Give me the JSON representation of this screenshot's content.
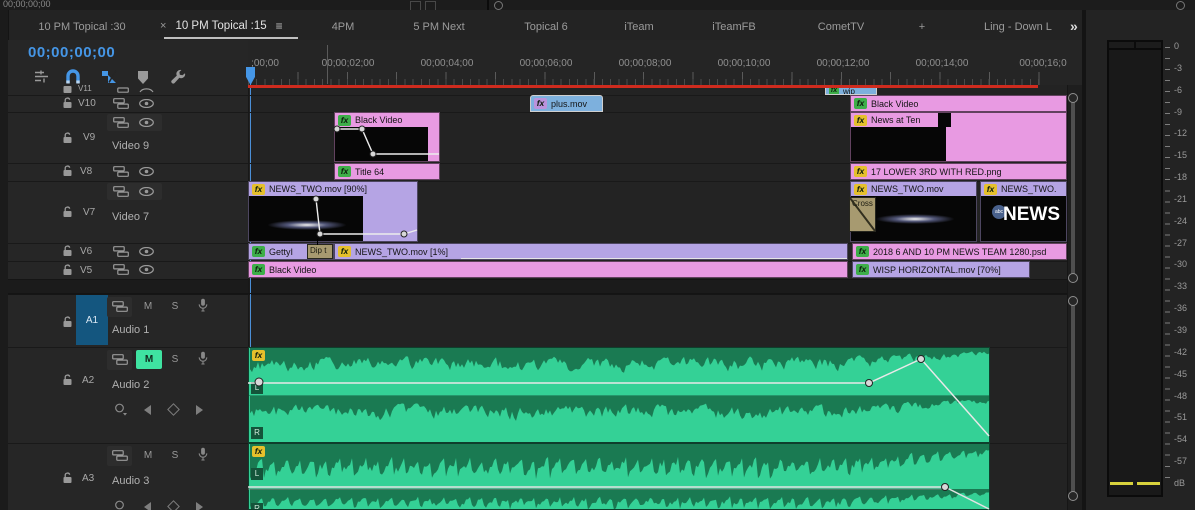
{
  "top_strip": {
    "timecode": "00;00;00;00"
  },
  "tab_bar": {
    "tabs": [
      {
        "label": "10 PM Topical :30"
      },
      {
        "label": "10 PM Topical :15",
        "close": "×",
        "menu": "≡"
      },
      {
        "label": "4PM"
      },
      {
        "label": "5 PM Next"
      },
      {
        "label": "Topical 6"
      },
      {
        "label": "iTeam"
      },
      {
        "label": "iTeamFB"
      },
      {
        "label": "CometTV"
      },
      {
        "label": "+"
      },
      {
        "label": "Ling - Down L"
      }
    ],
    "overflow": "»"
  },
  "toolbar": {
    "timecode": "00;00;00;00"
  },
  "ruler": {
    "labels": [
      ";00;00",
      "00;00;02;00",
      "00;00;04;00",
      "00;00;06;00",
      "00;00;08;00",
      "00;00;10;00",
      "00;00;12;00",
      "00;00;14;00",
      "00;00;16;0"
    ]
  },
  "tracks": {
    "v11": {
      "id": "V11"
    },
    "v10": {
      "id": "V10"
    },
    "v9": {
      "id": "V9",
      "name": "Video 9"
    },
    "v8": {
      "id": "V8"
    },
    "v7": {
      "id": "V7",
      "name": "Video 7"
    },
    "v6": {
      "id": "V6"
    },
    "v5": {
      "id": "V5"
    },
    "a1": {
      "id": "A1",
      "name": "Audio 1",
      "mute": "M",
      "solo": "S"
    },
    "a2": {
      "id": "A2",
      "name": "Audio 2",
      "mute": "M",
      "solo": "S"
    },
    "a3": {
      "id": "A3",
      "name": "Audio 3",
      "mute": "M",
      "solo": "S"
    }
  },
  "clips": {
    "wip": {
      "label": "wip"
    },
    "plus": {
      "label": "plus.mov"
    },
    "v10_black": {
      "label": "Black Video"
    },
    "v9_black": {
      "label": "Black Video"
    },
    "news_at_ten": {
      "label": "News at Ten"
    },
    "title_64": {
      "label": "Title 64"
    },
    "lower_third": {
      "label": "17 LOWER 3RD WITH RED.png"
    },
    "news_two_90": {
      "label": "NEWS_TWO.mov [90%]"
    },
    "news_two_a": {
      "label": "NEWS_TWO.mov"
    },
    "news_two_b": {
      "label": "NEWS_TWO."
    },
    "getty": {
      "label": "GettyI"
    },
    "news_two_1": {
      "label": "NEWS_TWO.mov [1%]"
    },
    "team_psd": {
      "label": "2018 6 AND 10 PM NEWS TEAM 1280.psd"
    },
    "v5_black": {
      "label": "Black Video"
    },
    "wisp": {
      "label": "WISP HORIZONTAL.mov [70%]"
    },
    "cross_transition": {
      "label": "Cross"
    },
    "dip_transition": {
      "label": "Dip t"
    },
    "news_thumb_text": {
      "label": "NEWS"
    },
    "abc_logo": {
      "label": "abc"
    }
  },
  "badges": {
    "fx": "fx",
    "left": "L",
    "right": "R"
  },
  "meter": {
    "scale": [
      "0",
      "-3",
      "-6",
      "-9",
      "-12",
      "-15",
      "-18",
      "-21",
      "-24",
      "-27",
      "-30",
      "-33",
      "-36",
      "-39",
      "-42",
      "-45",
      "-48",
      "-51",
      "-54",
      "-57",
      "dB"
    ]
  },
  "colors": {
    "accent_blue": "#4596e6",
    "clip_pink": "#e89ae2",
    "clip_purple": "#b5a4e4",
    "clip_blue": "#7db0dd",
    "audio_green": "#34d196",
    "mute_green": "#3fe3a1",
    "render_red": "#cf2b1e"
  }
}
